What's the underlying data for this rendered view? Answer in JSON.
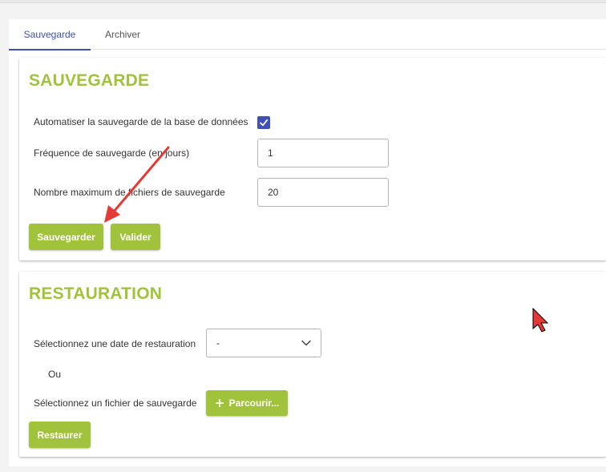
{
  "tabs": [
    {
      "label": "Sauvegarde",
      "active": true
    },
    {
      "label": "Archiver",
      "active": false
    }
  ],
  "backup": {
    "title": "SAUVEGARDE",
    "auto_label": "Automatiser la sauvegarde de la base de données",
    "auto_checked": true,
    "frequency_label": "Fréquence de sauvegarde (en jours)",
    "frequency_value": "1",
    "max_files_label": "Nombre maximum de fichiers de sauvegarde",
    "max_files_value": "20",
    "save_label": "Sauvegarder",
    "validate_label": "Valider"
  },
  "restore": {
    "title": "RESTAURATION",
    "date_label": "Sélectionnez une date de restauration",
    "date_value": "-",
    "or_label": "Ou",
    "file_label": "Sélectionnez un fichier de sauvegarde",
    "browse_label": "Parcourir...",
    "restore_label": "Restaurer"
  },
  "colors": {
    "accent_green": "#a1c33c",
    "primary_blue": "#3f51b5",
    "annotation_red": "#e53935"
  }
}
